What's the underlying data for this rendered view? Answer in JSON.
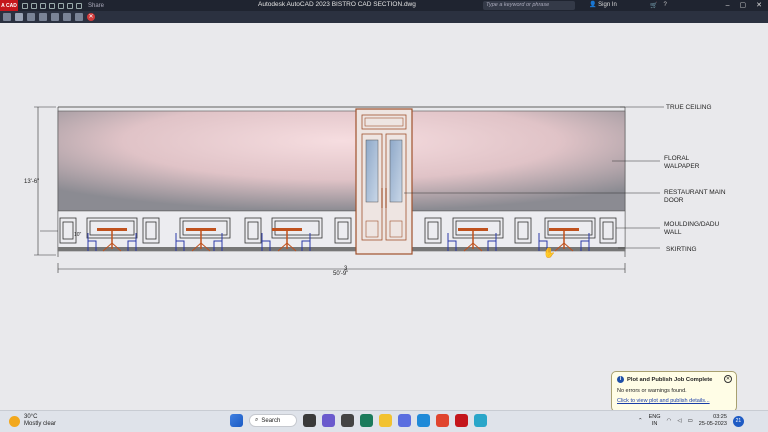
{
  "window": {
    "title": "Autodesk AutoCAD 2023    BISTRO CAD SECTION.dwg",
    "app_badge": "A CAD",
    "share_label": "Share",
    "search_placeholder": "Type a keyword or phrase",
    "signin_label": "Sign In"
  },
  "drawing": {
    "dim_height": "13'-6\"",
    "dim_width_top": "3",
    "dim_width": "50'-9\"",
    "dim_small": "10\"",
    "labels": {
      "true_ceiling": "TRUE CEILING",
      "floral": "FLORAL",
      "wallpaper": "WALPAPER",
      "door_1": "RESTAURANT MAIN",
      "door_2": "DOOR",
      "moulding_1": "MOULDING/DADU",
      "moulding_2": "WALL",
      "skirting": "SKIRTING"
    },
    "colors": {
      "wallpaper": "#f2d7da",
      "line": "#333333",
      "door": "#a0522d",
      "chair": "#2b3aa8",
      "table": "#c0521e"
    }
  },
  "notification": {
    "title": "Plot and Publish Job Complete",
    "message": "No errors or warnings found.",
    "link": "Click to view plot and publish details..."
  },
  "taskbar": {
    "temperature": "30°C",
    "condition": "Mostly clear",
    "search_label": "Search",
    "lang_1": "ENG",
    "lang_2": "IN",
    "time": "03:25",
    "date": "25-05-2023",
    "badge": "21"
  }
}
